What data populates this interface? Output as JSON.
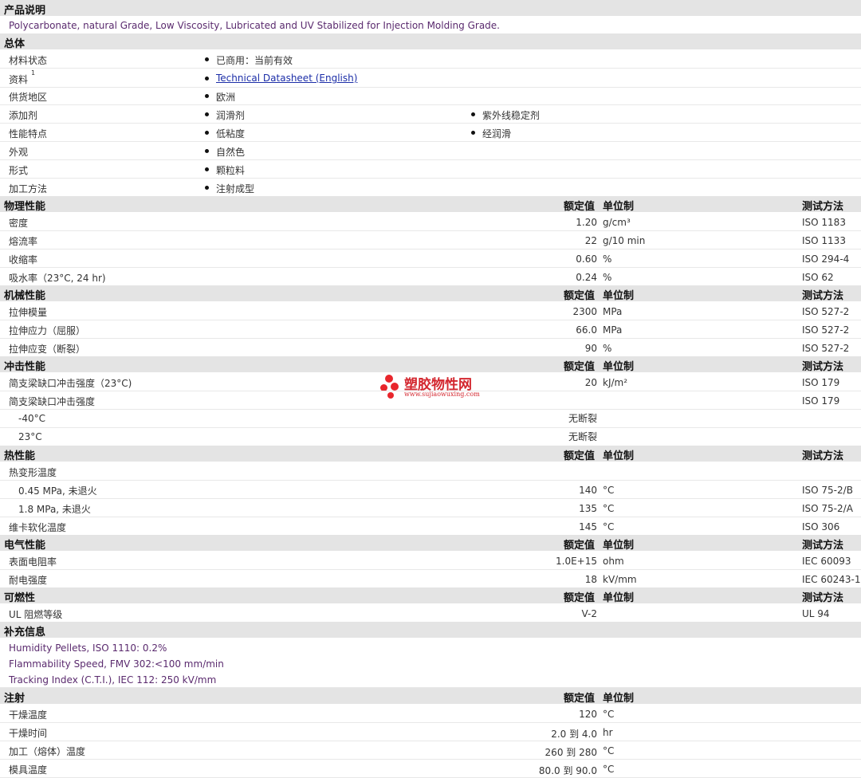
{
  "product": {
    "heading": "产品说明",
    "description": "Polycarbonate, natural Grade, Low Viscosity, Lubricated and UV Stabilized for Injection Molding Grade."
  },
  "general": {
    "heading": "总体",
    "rows": [
      {
        "label": "材料状态",
        "values": [
          "已商用：当前有效"
        ]
      },
      {
        "label": "资料",
        "sup": "1",
        "link": "Technical Datasheet (English)"
      },
      {
        "label": "供货地区",
        "values": [
          "欧洲"
        ]
      },
      {
        "label": "添加剂",
        "values": [
          "润滑剂",
          "紫外线稳定剂"
        ]
      },
      {
        "label": "性能特点",
        "values": [
          "低粘度",
          "经润滑"
        ]
      },
      {
        "label": "外观",
        "values": [
          "自然色"
        ]
      },
      {
        "label": "形式",
        "values": [
          "颗粒料"
        ]
      },
      {
        "label": "加工方法",
        "values": [
          "注射成型"
        ]
      }
    ]
  },
  "cols": {
    "value": "额定值",
    "unit": "单位制",
    "method": "测试方法"
  },
  "physical": {
    "heading": "物理性能",
    "rows": [
      {
        "label": "密度",
        "value": "1.20",
        "unit": "g/cm³",
        "method": "ISO 1183"
      },
      {
        "label": "熔流率",
        "value": "22",
        "unit": "g/10 min",
        "method": "ISO 1133"
      },
      {
        "label": "收缩率",
        "value": "0.60",
        "unit": "%",
        "method": "ISO 294-4"
      },
      {
        "label": "吸水率（23°C, 24 hr)",
        "value": "0.24",
        "unit": "%",
        "method": "ISO 62"
      }
    ]
  },
  "mechanical": {
    "heading": "机械性能",
    "rows": [
      {
        "label": "拉伸模量",
        "value": "2300",
        "unit": "MPa",
        "method": "ISO 527-2"
      },
      {
        "label": "拉伸应力（屈服）",
        "value": "66.0",
        "unit": "MPa",
        "method": "ISO 527-2"
      },
      {
        "label": "拉伸应变（断裂）",
        "value": "90",
        "unit": "%",
        "method": "ISO 527-2"
      }
    ]
  },
  "impact": {
    "heading": "冲击性能",
    "rows": [
      {
        "label": "简支梁缺口冲击强度（23°C)",
        "value": "20",
        "unit": "kJ/m²",
        "method": "ISO 179"
      },
      {
        "label": "简支梁缺口冲击强度",
        "value": "",
        "unit": "",
        "method": "ISO 179"
      },
      {
        "label": "-40°C",
        "value": "无断裂",
        "unit": "",
        "method": ""
      },
      {
        "label": "23°C",
        "value": "无断裂",
        "unit": "",
        "method": ""
      }
    ]
  },
  "thermal": {
    "heading": "热性能",
    "rows": [
      {
        "label": "热变形温度",
        "value": "",
        "unit": "",
        "method": ""
      },
      {
        "label": "0.45 MPa, 未退火",
        "value": "140",
        "unit": "°C",
        "method": "ISO 75-2/B"
      },
      {
        "label": "1.8 MPa, 未退火",
        "value": "135",
        "unit": "°C",
        "method": "ISO 75-2/A"
      },
      {
        "label": "维卡软化温度",
        "value": "145",
        "unit": "°C",
        "method": "ISO 306"
      }
    ]
  },
  "electrical": {
    "heading": "电气性能",
    "rows": [
      {
        "label": "表面电阻率",
        "value": "1.0E+15",
        "unit": "ohm",
        "method": "IEC 60093"
      },
      {
        "label": "耐电强度",
        "value": "18",
        "unit": "kV/mm",
        "method": "IEC 60243-1"
      }
    ]
  },
  "flammability": {
    "heading": "可燃性",
    "rows": [
      {
        "label": "UL 阻燃等级",
        "value": "V-2",
        "unit": "",
        "method": "UL 94"
      }
    ]
  },
  "supplement": {
    "heading": "补充信息",
    "lines": [
      "Humidity Pellets, ISO 1110: 0.2%",
      "Flammability Speed, FMV 302:<100 mm/min",
      "Tracking Index (C.T.I.), IEC 112: 250 kV/mm"
    ]
  },
  "injection": {
    "heading": "注射",
    "rows": [
      {
        "label": "干燥温度",
        "value": "120",
        "unit": "°C"
      },
      {
        "label": "干燥时间",
        "value": "2.0 到  4.0",
        "unit": "hr"
      },
      {
        "label": "加工（熔体）温度",
        "value": "260 到  280",
        "unit": "°C"
      },
      {
        "label": "模具温度",
        "value": "80.0 到  90.0",
        "unit": "°C"
      }
    ]
  },
  "watermark": {
    "name": "塑胶物性网",
    "url": "www.sujiaowuxing.com"
  }
}
